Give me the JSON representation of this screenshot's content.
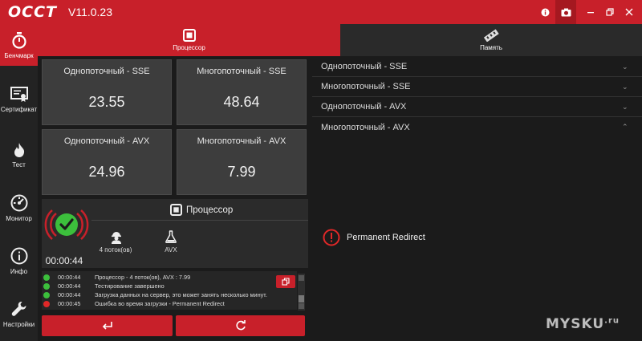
{
  "app": {
    "logo": "OCCT",
    "version": "V11.0.23"
  },
  "sidebar": {
    "items": [
      {
        "label": "Бенчмарк",
        "icon": "stopwatch-icon",
        "active": true
      },
      {
        "label": "Сертификат",
        "icon": "certificate-icon",
        "active": false
      },
      {
        "label": "Тест",
        "icon": "flame-icon",
        "active": false
      },
      {
        "label": "Монитор",
        "icon": "gauge-icon",
        "active": false
      },
      {
        "label": "Инфо",
        "icon": "info-icon",
        "active": false
      },
      {
        "label": "Настройки",
        "icon": "wrench-icon",
        "active": false
      }
    ]
  },
  "tabs": {
    "cpu": {
      "label": "Процессор",
      "icon": "cpu-icon",
      "active": true
    },
    "memory": {
      "label": "Память",
      "icon": "memory-icon",
      "active": false
    }
  },
  "cards": [
    {
      "title": "Однопоточный - SSE",
      "value": "23.55"
    },
    {
      "title": "Многопоточный - SSE",
      "value": "48.64"
    },
    {
      "title": "Однопоточный - AVX",
      "value": "24.96"
    },
    {
      "title": "Многопоточный - AVX",
      "value": "7.99"
    }
  ],
  "status": {
    "timer": "00:00:44",
    "title": "Процессор",
    "threads_label": "4 поток(ов)",
    "instruction_label": "AVX"
  },
  "log": [
    {
      "time": "00:00:44",
      "text": "Процессор - 4 поток(ов), AVX : 7.99",
      "status": "ok"
    },
    {
      "time": "00:00:44",
      "text": "Тестирование завершено",
      "status": "ok"
    },
    {
      "time": "00:00:44",
      "text": "Загрузка данных на сервер, это может занять несколько минут.",
      "status": "ok"
    },
    {
      "time": "00:00:45",
      "text": "Ошибка во время загрузки - Permanent Redirect",
      "status": "error"
    }
  ],
  "results": {
    "items": [
      {
        "label": "Однопоточный - SSE",
        "expanded": false
      },
      {
        "label": "Многопоточный - SSE",
        "expanded": false
      },
      {
        "label": "Однопоточный - AVX",
        "expanded": false
      },
      {
        "label": "Многопоточный - AVX",
        "expanded": true
      }
    ],
    "error": "Permanent Redirect"
  },
  "watermark": {
    "text": "MYSKU",
    "suffix": ".ru"
  },
  "colors": {
    "accent": "#c8202a",
    "ok": "#3cbf3c",
    "error": "#e02828"
  }
}
